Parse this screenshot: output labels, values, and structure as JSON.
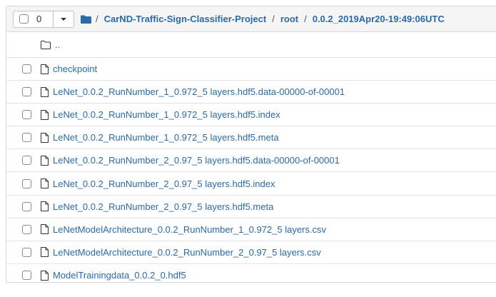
{
  "toolbar": {
    "selected_count": "0"
  },
  "breadcrumb": {
    "separator": "/",
    "items": [
      "CarND-Traffic-Sign-Classifier-Project",
      "root",
      "0.0.2_2019Apr20-19:49:06UTC"
    ]
  },
  "listing": {
    "parent": "..",
    "files": [
      "checkpoint",
      "LeNet_0.0.2_RunNumber_1_0.972_5 layers.hdf5.data-00000-of-00001",
      "LeNet_0.0.2_RunNumber_1_0.972_5 layers.hdf5.index",
      "LeNet_0.0.2_RunNumber_1_0.972_5 layers.hdf5.meta",
      "LeNet_0.0.2_RunNumber_2_0.97_5 layers.hdf5.data-00000-of-00001",
      "LeNet_0.0.2_RunNumber_2_0.97_5 layers.hdf5.index",
      "LeNet_0.0.2_RunNumber_2_0.97_5 layers.hdf5.meta",
      "LeNetModelArchitecture_0.0.2_RunNumber_1_0.972_5 layers.csv",
      "LeNetModelArchitecture_0.0.2_RunNumber_2_0.97_5 layers.csv",
      "ModelTrainingdata_0.0.2_0.hdf5"
    ]
  },
  "colors": {
    "link": "#2a6aa8",
    "header_bg": "#f5f5f5",
    "border": "#d6d6d6"
  },
  "icons": {
    "folder": "folder-icon",
    "file": "file-icon",
    "checkbox": "checkbox",
    "dropdown": "chevron-down-icon"
  }
}
